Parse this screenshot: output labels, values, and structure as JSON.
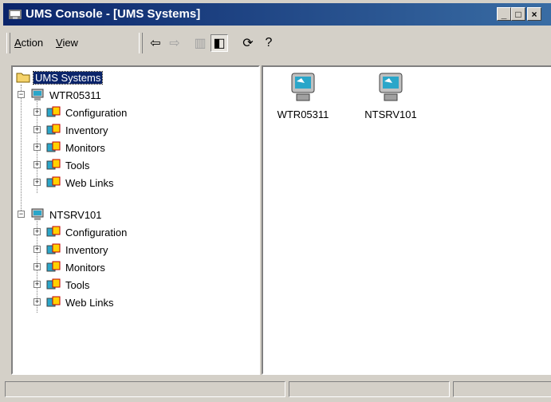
{
  "window": {
    "title": "UMS Console - [UMS Systems]",
    "minimize": "_",
    "maximize": "□",
    "close": "×"
  },
  "menu": {
    "action": "Action",
    "view": "View"
  },
  "toolbar": {
    "back_icon": "back-arrow-icon",
    "forward_icon": "forward-arrow-icon"
  },
  "tree": {
    "root": "UMS Systems",
    "systems": [
      {
        "name": "WTR05311",
        "children": [
          "Configuration",
          "Inventory",
          "Monitors",
          "Tools",
          "Web Links"
        ]
      },
      {
        "name": "NTSRV101",
        "children": [
          "Configuration",
          "Inventory",
          "Monitors",
          "Tools",
          "Web Links"
        ]
      }
    ]
  },
  "content": {
    "items": [
      "WTR05311",
      "NTSRV101"
    ]
  },
  "colors": {
    "titlebar": "#0a246a",
    "selection": "#0a246a",
    "face": "#d4d0c8"
  }
}
